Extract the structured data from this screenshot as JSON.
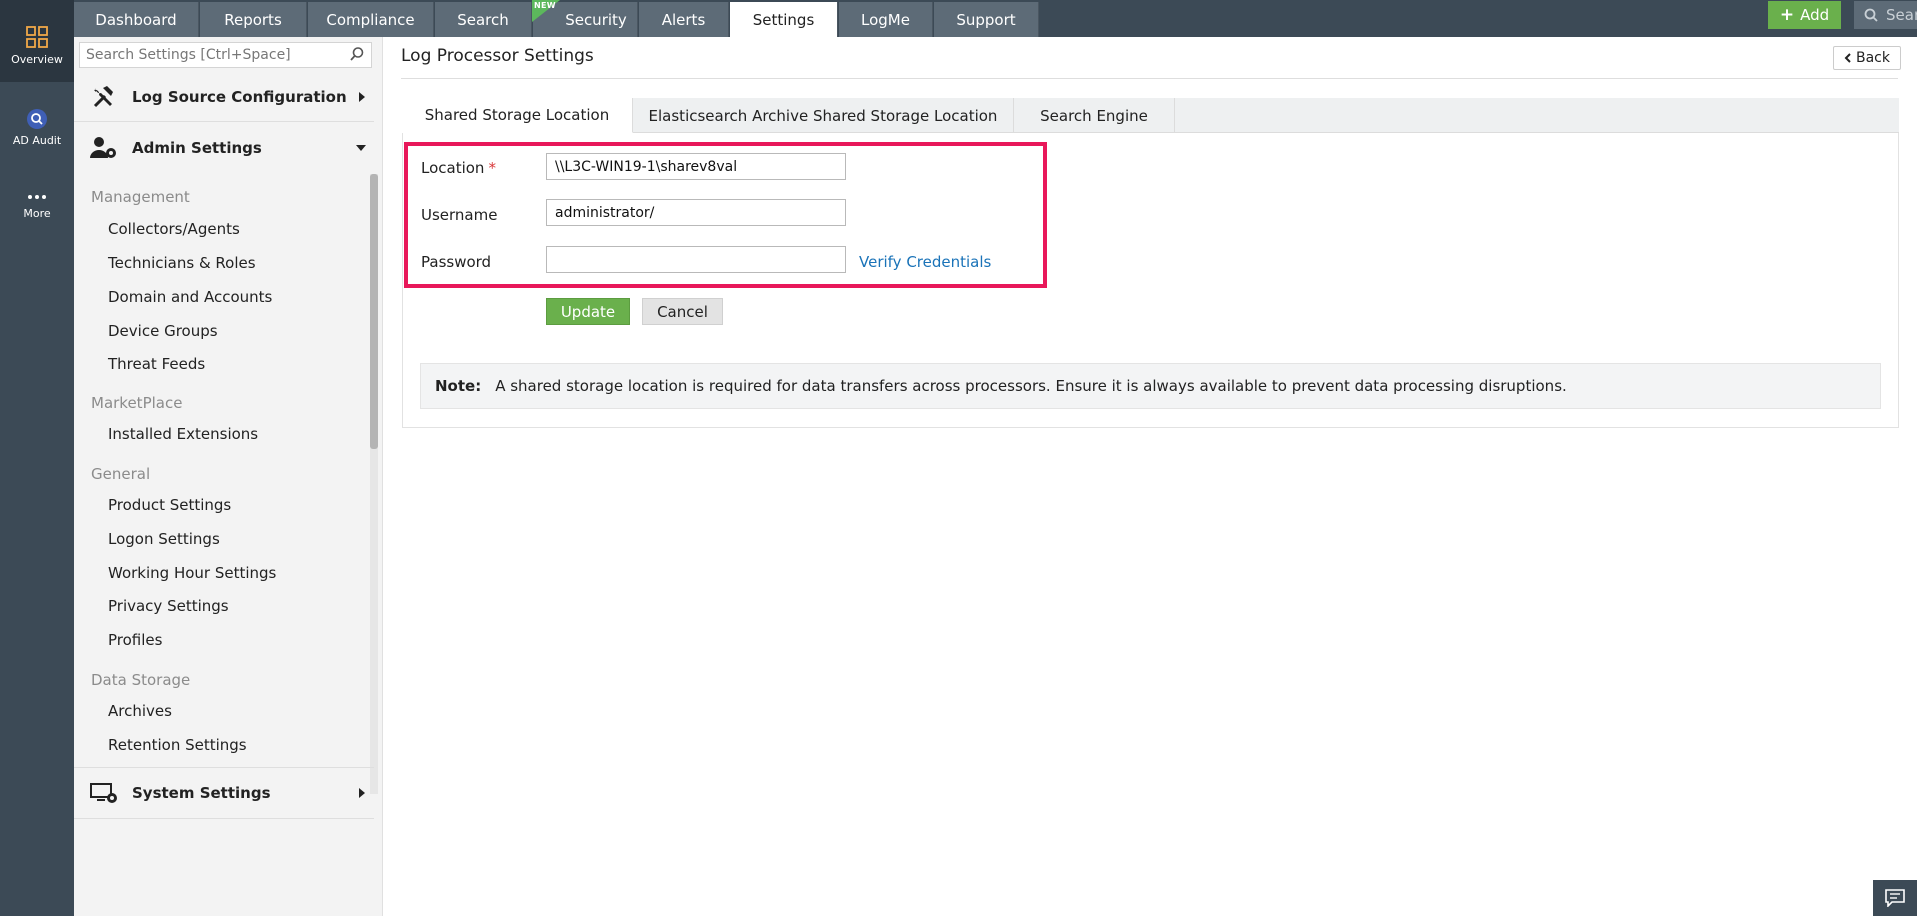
{
  "rail": {
    "items": [
      {
        "label": "Overview"
      },
      {
        "label": "AD Audit"
      },
      {
        "label": "More"
      }
    ]
  },
  "nav": {
    "tabs": [
      {
        "label": "Dashboard"
      },
      {
        "label": "Reports"
      },
      {
        "label": "Compliance"
      },
      {
        "label": "Search"
      },
      {
        "label": "Security",
        "badge": "NEW"
      },
      {
        "label": "Alerts"
      },
      {
        "label": "Settings",
        "active": true
      },
      {
        "label": "LogMe"
      },
      {
        "label": "Support"
      }
    ],
    "add_label": "Add",
    "search_placeholder": "Search"
  },
  "sidebar": {
    "search_placeholder": "Search Settings [Ctrl+Space]",
    "sections": [
      {
        "label": "Log Source Configuration"
      },
      {
        "label": "Admin Settings"
      },
      {
        "label": "System Settings"
      }
    ],
    "groups": [
      {
        "label": "Management",
        "items": [
          "Collectors/Agents",
          "Technicians & Roles",
          "Domain and Accounts",
          "Device Groups",
          "Threat Feeds"
        ]
      },
      {
        "label": "MarketPlace",
        "items": [
          "Installed Extensions"
        ]
      },
      {
        "label": "General",
        "items": [
          "Product Settings",
          "Logon Settings",
          "Working Hour Settings",
          "Privacy Settings",
          "Profiles"
        ]
      },
      {
        "label": "Data Storage",
        "items": [
          "Archives",
          "Retention Settings"
        ]
      }
    ]
  },
  "main": {
    "title": "Log Processor Settings",
    "back_label": "Back",
    "tabs": [
      {
        "label": "Shared Storage Location",
        "active": true
      },
      {
        "label": "Elasticsearch Archive Shared Storage Location"
      },
      {
        "label": "Search Engine"
      }
    ],
    "form": {
      "location_label": "Location",
      "required_mark": "*",
      "location_value": "\\\\L3C-WIN19-1\\sharev8val",
      "username_label": "Username",
      "username_value": "administrator/",
      "password_label": "Password",
      "password_value": "",
      "verify_label": "Verify Credentials",
      "update_label": "Update",
      "cancel_label": "Cancel"
    },
    "note": {
      "label": "Note:",
      "text": "A shared storage location is required for data transfers across processors. Ensure it is always available to prevent data processing disruptions."
    }
  },
  "colors": {
    "rail": "#3c4a56",
    "accent_green": "#6ab04c",
    "highlight": "#e8185a",
    "link": "#1a73b8"
  }
}
